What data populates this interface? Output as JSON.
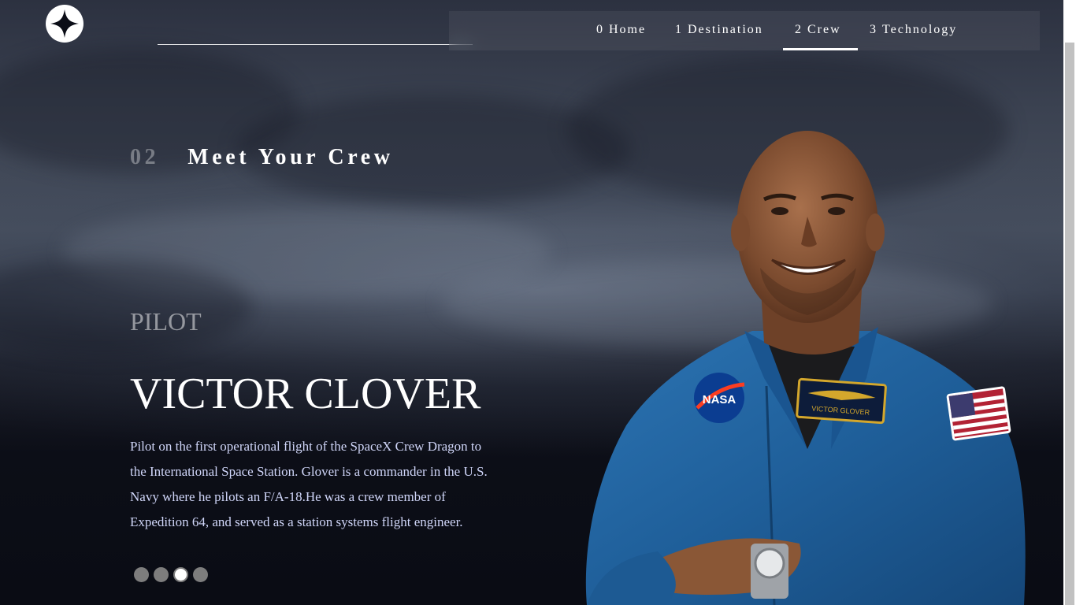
{
  "logo": {
    "icon": "four-point-star-icon"
  },
  "nav": {
    "items": [
      {
        "number": "0",
        "label": "Home",
        "active": false
      },
      {
        "number": "1",
        "label": "Destination",
        "active": false
      },
      {
        "number": "2",
        "label": "Crew",
        "active": true
      },
      {
        "number": "3",
        "label": "Technology",
        "active": false
      }
    ]
  },
  "page_heading": {
    "number": "02",
    "title": "Meet Your Crew"
  },
  "crew_member": {
    "role": "PILOT",
    "name": "VICTOR CLOVER",
    "bio": "Pilot on the first operational flight of the SpaceX Crew Dragon to the International Space Station. Glover is a commander in the U.S. Navy where he pilots an F/A-18.He was a crew member of Expedition 64, and served as a station systems flight engineer.",
    "name_tag": "VICTOR GLOVER",
    "badge": "NASA"
  },
  "pagination": {
    "count": 4,
    "active_index": 2
  },
  "colors": {
    "background": "#0b0d17",
    "text_light": "#d0d6f9",
    "suit_blue": "#1f5f9a",
    "dot_inactive": "#7d7d7d"
  }
}
